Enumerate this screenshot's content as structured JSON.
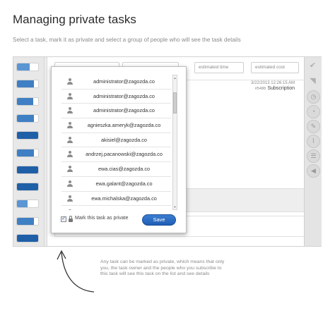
{
  "page": {
    "title": "Managing private tasks",
    "subtitle": "Select a task, mark it as private and select a group of people who will see the task details"
  },
  "left_strip": {
    "bars": [
      {
        "fill_fraction": 0.6,
        "color": "#5b95d3"
      },
      {
        "fill_fraction": 0.8,
        "color": "#3f7fc4"
      },
      {
        "fill_fraction": 0.75,
        "color": "#3f7fc4"
      },
      {
        "fill_fraction": 0.8,
        "color": "#3f7fc4"
      },
      {
        "fill_fraction": 1.0,
        "color": "#1f5fa8"
      },
      {
        "fill_fraction": 0.8,
        "color": "#3f7fc4"
      },
      {
        "fill_fraction": 1.0,
        "color": "#1f5fa8"
      },
      {
        "fill_fraction": 1.0,
        "color": "#1f5fa8"
      },
      {
        "fill_fraction": 0.5,
        "color": "#5b95d3"
      },
      {
        "fill_fraction": 0.8,
        "color": "#3f7fc4"
      },
      {
        "fill_fraction": 1.0,
        "color": "#1f5fa8"
      }
    ]
  },
  "main": {
    "estimated_time_placeholder": "estimated time",
    "estimated_cost_placeholder": "estimated cost",
    "task": {
      "date": "3/22/2013 12:26:15 AM",
      "id": "#5488",
      "name": "Subscription"
    }
  },
  "popup": {
    "users": [
      "administrator@zagozda.co",
      "administrator@zagozda.co",
      "administrator@zagozda.co",
      "agnieszka.ameryk@zagozda.co",
      "akisiel@zagozda.co",
      "andrzej.pacanowski@zagozda.co",
      "ewa.cias@zagozda.co",
      "ewa.galant@zagozda.co",
      "ewa.michalska@zagozda.co",
      "ewa.pioterczak@zagozda.co"
    ],
    "private_checkbox_label": "Mark this task as private",
    "private_checked": true,
    "check_glyph": "✓",
    "save_label": "Save"
  },
  "right_toolbar": {
    "icons": [
      "check-icon",
      "tag-icon",
      "clock-icon",
      "pie-chart-icon",
      "pencil-icon",
      "paperclip-icon",
      "list-icon",
      "send-icon"
    ]
  },
  "annotation": {
    "text": "Any task can be marked as private, which means that only you, the task owner and the people who you subscribe to this task will see this task on the list and see details"
  },
  "colors": {
    "accent": "#2a6bc4",
    "save_button": "#2a6bc4"
  }
}
